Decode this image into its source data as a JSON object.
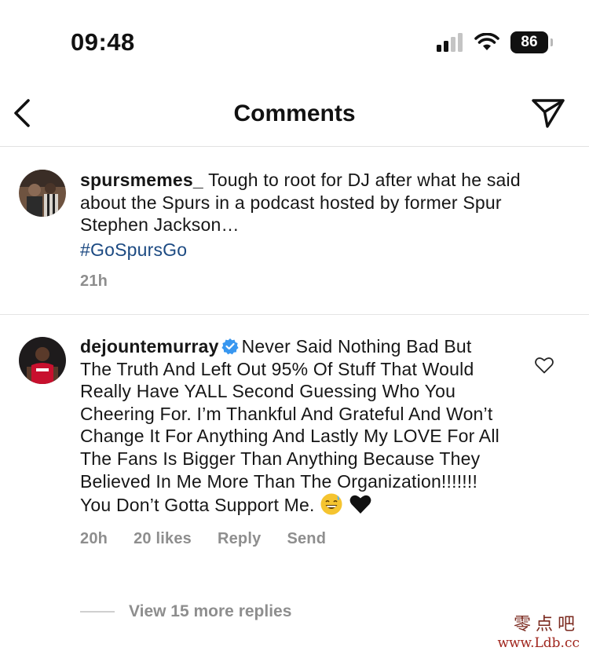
{
  "status_bar": {
    "time": "09:48",
    "battery": "86",
    "icons": [
      "cellular-signal-icon",
      "wifi-icon",
      "battery-icon"
    ]
  },
  "header": {
    "title": "Comments",
    "back_icon": "chevron-left-icon",
    "share_icon": "paper-plane-icon"
  },
  "comments": [
    {
      "username": "spursmemes_",
      "text": "Tough to root for DJ after what he said about the Spurs in a podcast hosted by former Spur Stephen Jackson…",
      "hashtag": "#GoSpursGo",
      "time": "21h"
    },
    {
      "username": "dejountemurray",
      "verified": true,
      "text": "Never Said Nothing Bad But The Truth And Left Out 95% Of Stuff That Would Really Have YALL Second Guessing Who You Cheering For. I’m Thankful And Grateful And Won’t Change It For Anything And Lastly My LOVE For All The Fans Is Bigger Than Anything Because They Believed In Me More Than The Organization!!!!!!! You Don’t Gotta Support Me.",
      "emojis": [
        "grinning-sweat-emoji",
        "black-heart-emoji"
      ],
      "time": "20h",
      "likes": "20 likes",
      "reply_label": "Reply",
      "send_label": "Send",
      "like_icon": "heart-outline-icon"
    }
  ],
  "view_replies": "View 15 more replies",
  "watermark": {
    "text": "零点吧",
    "url": "www.Ldb.cc"
  },
  "colors": {
    "hashtag": "#1c4a82",
    "meta": "#8e8e8e",
    "verified": "#3897f0"
  }
}
